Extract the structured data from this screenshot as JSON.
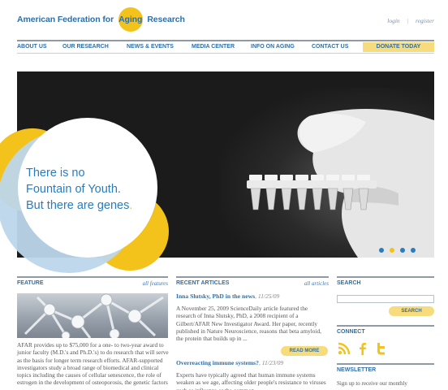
{
  "header": {
    "logo_part1": "American Federation for",
    "logo_aging": "Aging",
    "logo_part2": "Research",
    "login": "login",
    "separator": "|",
    "register": "register"
  },
  "nav": {
    "items": [
      "ABOUT US",
      "OUR RESEARCH",
      "NEWS & EVENTS",
      "MEDIA CENTER",
      "INFO ON AGING",
      "CONTACT US"
    ],
    "donate": "DONATE TODAY"
  },
  "hero": {
    "line1": "There is no",
    "line2": "Fountain of Youth.",
    "line3": "But there are genes",
    "line3_dot": ".",
    "dot_colors": [
      "#2b7cbf",
      "#f3c21b",
      "#2b7cbf",
      "#2b7cbf"
    ]
  },
  "feature": {
    "title": "FEATURE",
    "link": "all features",
    "body": "AFAR provides up to $75,000 for a one- to two-year award to junior faculty (M.D.'s and Ph.D.'s) to do research that will serve as the basis for longer term research efforts. AFAR-supported investigators study a broad range of biomedical and clinical topics including the causes of cellular senescence, the role of estrogen in the development of osteoporosis, the genetic factors"
  },
  "articles": {
    "title": "RECENT ARTICLES",
    "link": "all articles",
    "items": [
      {
        "title": "Inna Slutsky, PhD in the news",
        "date": "11/25/09",
        "body": "A November 25, 2009 ScienceDaily article featured the research of Inna Slutsky, PhD, a 2008 recipient of a Gilbert/AFAR New Investigator Award. Her paper, recently published in Nature Neuroscience, reasons that beta amyloid, the protein that builds up in ..."
      },
      {
        "title": "Overreacting immune systems?",
        "date": "11/23/09",
        "body": "Experts have typically agreed that human immune systems weaken as we age, affecting older people's resistance to viruses such as influenza or the common"
      }
    ],
    "read_more": "READ MORE"
  },
  "sidebar": {
    "search_title": "SEARCH",
    "search_placeholder": "",
    "search_button": "SEARCH",
    "connect_title": "CONNECT",
    "newsletter_title": "NEWSLETTER",
    "newsletter_text": "Sign up to receive our monthly"
  },
  "colors": {
    "brand_blue": "#2f6fa8",
    "accent_yellow": "#f3c21b",
    "button_yellow": "#f7dc7e"
  }
}
